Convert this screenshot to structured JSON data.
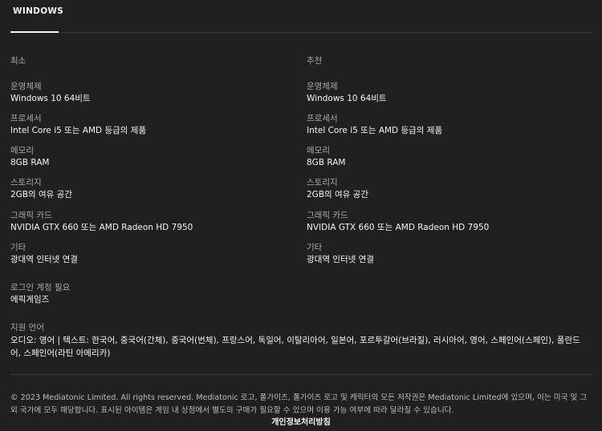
{
  "tabs": [
    {
      "label": "WINDOWS"
    }
  ],
  "minimum": {
    "header": "최소",
    "specs": [
      {
        "label": "운영체제",
        "value": "Windows 10 64비트"
      },
      {
        "label": "프로세서",
        "value": "Intel Core i5 또는 AMD 등급의 제품"
      },
      {
        "label": "메모리",
        "value": "8GB RAM"
      },
      {
        "label": "스토리지",
        "value": "2GB의 여유 공간"
      },
      {
        "label": "그래픽 카드",
        "value": "NVIDIA GTX 660 또는 AMD Radeon HD 7950"
      },
      {
        "label": "기타",
        "value": "광대역 인터넷 연결"
      }
    ]
  },
  "recommended": {
    "header": "추천",
    "specs": [
      {
        "label": "운영체제",
        "value": "Windows 10 64비트"
      },
      {
        "label": "프로세서",
        "value": "Intel Core i5 또는 AMD 등급의 제품"
      },
      {
        "label": "메모리",
        "value": "8GB RAM"
      },
      {
        "label": "스토리지",
        "value": "2GB의 여유 공간"
      },
      {
        "label": "그래픽 카드",
        "value": "NVIDIA GTX 660 또는 AMD Radeon HD 7950"
      },
      {
        "label": "기타",
        "value": "광대역 인터넷 연결"
      }
    ]
  },
  "login": {
    "label": "로그인 계정 필요",
    "value": "에픽게임즈"
  },
  "languages": {
    "label": "지원 언어",
    "value": "오디오: 영어 | 텍스트: 한국어, 중국어(간체), 중국어(번체), 프랑스어, 독일어, 이탈리아어, 일본어, 포르투갈어(브라질), 러시아어, 영어, 스페인어(스페인), 폴란드어, 스페인어(라틴 아메리카)"
  },
  "footer": {
    "copyright": "© 2023 Mediatonic Limited. All rights reserved. Mediatonic 로고, 폴가이즈, 폴가이즈 로고 및 캐릭터의 모든 저작권은 Mediatonic Limited에 있으며, 이는 미국 및 그 외 국가에 모두 해당합니다. 표시된 아이템은 게임 내 상점에서 별도의 구매가 필요할 수 있으며 이용 가능 여부에 따라 달라질 수 있습니다.",
    "privacy_link": "개인정보처리방침"
  }
}
